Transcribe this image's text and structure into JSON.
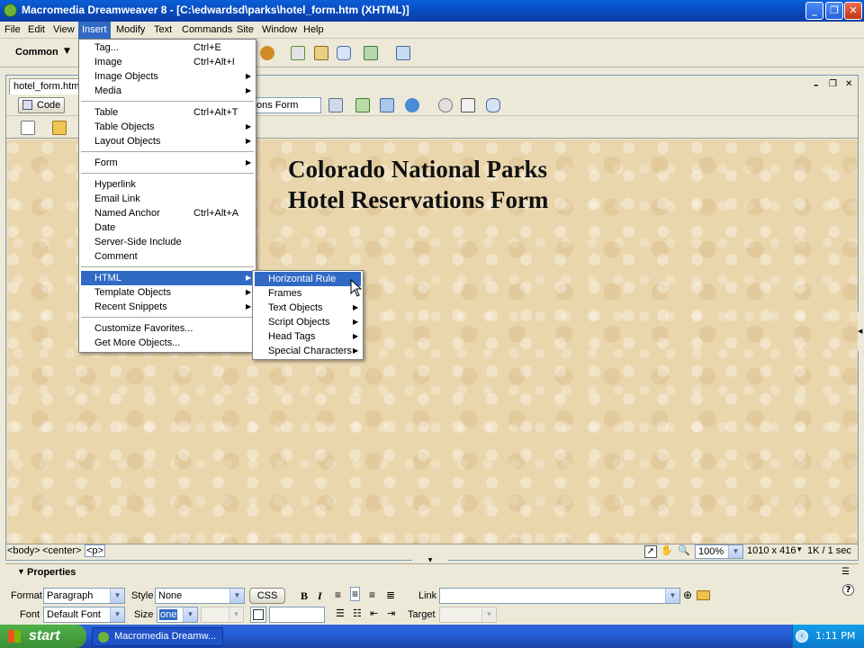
{
  "window": {
    "title": "Macromedia Dreamweaver 8 - [C:\\edwardsd\\parks\\hotel_form.htm (XHTML)]",
    "buttons": {
      "minimize": "_",
      "maximize": "❐",
      "close": "✕"
    }
  },
  "menubar": [
    "File",
    "Edit",
    "View",
    "Insert",
    "Modify",
    "Text",
    "Commands",
    "Site",
    "Window",
    "Help"
  ],
  "insertbar": {
    "category": "Common",
    "dropdown_glyph": "▼"
  },
  "document": {
    "tab_label": "hotel_form.htm",
    "code_button": "Code",
    "title_field": "ons Form",
    "window_controls": {
      "minimize": "–",
      "restore": "❐",
      "close": "✕"
    },
    "heading_line1": "Colorado National Parks",
    "heading_line2": "Hotel Reservations Form"
  },
  "insert_menu": {
    "items": [
      {
        "label": "Tag...",
        "shortcut": "Ctrl+E"
      },
      {
        "label": "Image",
        "shortcut": "Ctrl+Alt+I"
      },
      {
        "label": "Image Objects",
        "submenu": "▶"
      },
      {
        "label": "Media",
        "submenu": "▶"
      },
      {
        "label": "Table",
        "shortcut": "Ctrl+Alt+T"
      },
      {
        "label": "Table Objects",
        "submenu": "▶"
      },
      {
        "label": "Layout Objects",
        "submenu": "▶"
      },
      {
        "label": "Form",
        "submenu": "▶"
      },
      {
        "label": "Hyperlink"
      },
      {
        "label": "Email Link"
      },
      {
        "label": "Named Anchor",
        "shortcut": "Ctrl+Alt+A"
      },
      {
        "label": "Date"
      },
      {
        "label": "Server-Side Include"
      },
      {
        "label": "Comment"
      },
      {
        "label": "HTML",
        "submenu": "▶"
      },
      {
        "label": "Template Objects",
        "submenu": "▶"
      },
      {
        "label": "Recent Snippets",
        "submenu": "▶"
      },
      {
        "label": "Customize Favorites..."
      },
      {
        "label": "Get More Objects..."
      }
    ]
  },
  "html_submenu": {
    "items": [
      {
        "label": "Horizontal Rule"
      },
      {
        "label": "Frames"
      },
      {
        "label": "Text Objects",
        "submenu": "▶"
      },
      {
        "label": "Script Objects",
        "submenu": "▶"
      },
      {
        "label": "Head Tags",
        "submenu": "▶"
      },
      {
        "label": "Special Characters",
        "submenu": "▶"
      }
    ]
  },
  "tag_selector": {
    "tags": [
      "<body>",
      "<center>",
      "<p>"
    ]
  },
  "status": {
    "zoom": "100%",
    "dimensions": "1010 x 416",
    "download": "1K / 1 sec"
  },
  "properties": {
    "title": "Properties",
    "format_label": "Format",
    "format_value": "Paragraph",
    "style_label": "Style",
    "style_value": "None",
    "css_button": "CSS",
    "bold": "B",
    "italic": "I",
    "link_label": "Link",
    "link_value": "",
    "font_label": "Font",
    "font_value": "Default Font",
    "size_label": "Size",
    "size_value": "one",
    "target_label": "Target",
    "target_value": "",
    "help": "?"
  },
  "taskbar": {
    "start": "start",
    "task": "Macromedia Dreamw...",
    "clock": "1:11 PM"
  }
}
